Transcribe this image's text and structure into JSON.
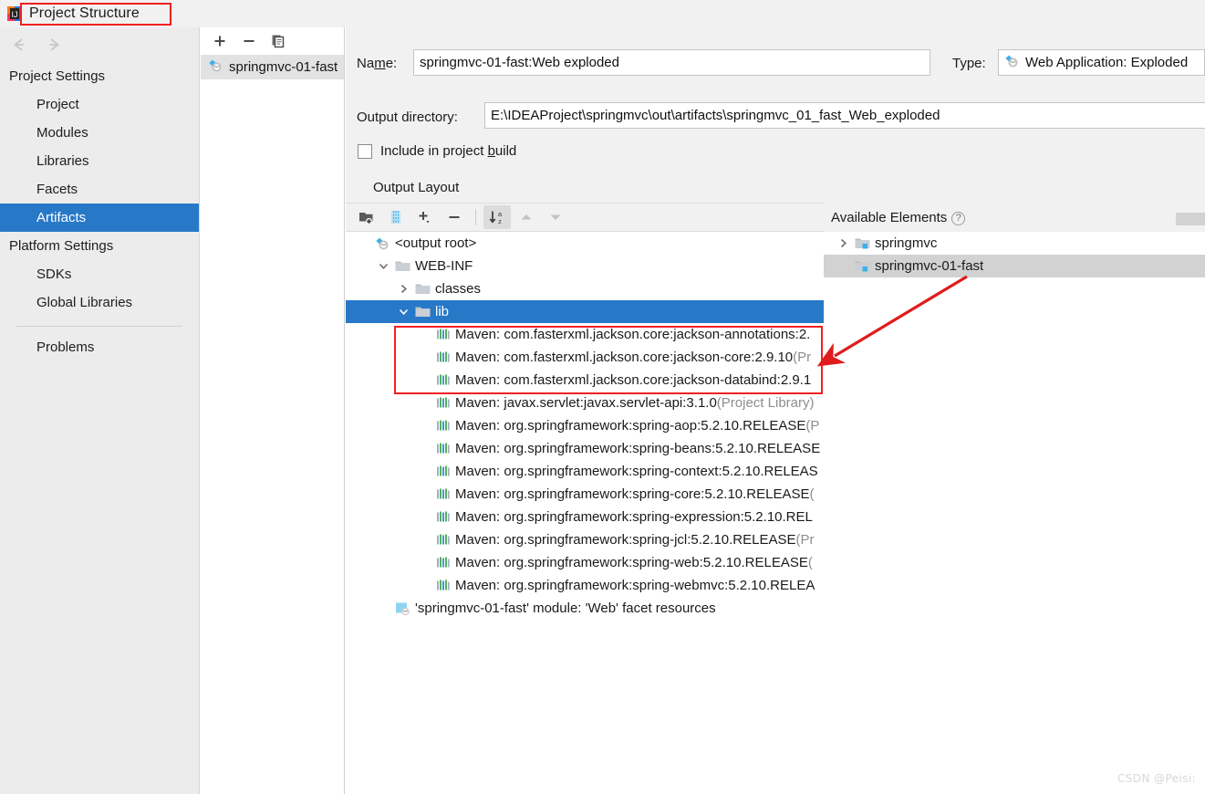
{
  "window": {
    "title": "Project Structure",
    "logo_icon": "intellij-idea-logo-icon"
  },
  "nav": {
    "back_icon": "arrow-left-icon",
    "forward_icon": "arrow-right-icon"
  },
  "sidebar": {
    "groups": [
      {
        "label": "Project Settings",
        "items": [
          {
            "label": "Project",
            "selected": false
          },
          {
            "label": "Modules",
            "selected": false
          },
          {
            "label": "Libraries",
            "selected": false
          },
          {
            "label": "Facets",
            "selected": false
          },
          {
            "label": "Artifacts",
            "selected": true
          }
        ]
      },
      {
        "label": "Platform Settings",
        "items": [
          {
            "label": "SDKs",
            "selected": false
          },
          {
            "label": "Global Libraries",
            "selected": false
          }
        ]
      }
    ],
    "problems": "Problems"
  },
  "artifacts_panel": {
    "toolbar": [
      {
        "name": "add-artifact-button",
        "glyph": "+"
      },
      {
        "name": "remove-artifact-button",
        "glyph": "−"
      },
      {
        "name": "copy-artifact-button",
        "glyph": "copy-icon"
      }
    ],
    "items": [
      {
        "label": "springmvc-01-fast",
        "icon": "artifact-icon",
        "selected": true
      }
    ]
  },
  "detail": {
    "name_label": "Name:",
    "name_label_mnemonic": "m",
    "name_value": "springmvc-01-fast:Web exploded",
    "type_label": "Type:",
    "type_value": "Web Application: Exploded",
    "type_icon": "artifact-icon",
    "output_dir_label": "Output directory:",
    "output_dir_value": "E:\\IDEAProject\\springmvc\\out\\artifacts\\springmvc_01_fast_Web_exploded",
    "include_checkbox_label": "Include in project build",
    "include_checked": false,
    "output_layout_label": "Output Layout"
  },
  "layout_toolbar": [
    {
      "name": "add-directory-button",
      "icon": "folder-add-icon",
      "active": false
    },
    {
      "name": "add-archive-button",
      "icon": "archive-icon",
      "active": false
    },
    {
      "name": "add-element-button",
      "icon": "plus-dropdown-icon",
      "active": false
    },
    {
      "name": "remove-element-button",
      "icon": "minus-icon",
      "active": false
    },
    {
      "name": "sort-alphabetically-button",
      "icon": "sort-az-icon",
      "active": true
    },
    {
      "name": "move-up-button",
      "icon": "chevron-up-icon",
      "active": false
    },
    {
      "name": "move-down-button",
      "icon": "chevron-down-icon",
      "active": false
    }
  ],
  "output_tree": [
    {
      "label": "<output root>",
      "icon": "artifact-icon",
      "indent": 0,
      "twist": "none",
      "selected": false,
      "suffix": ""
    },
    {
      "label": "WEB-INF",
      "icon": "folder-icon",
      "indent": 1,
      "twist": "expanded",
      "selected": false,
      "suffix": ""
    },
    {
      "label": "classes",
      "icon": "folder-icon",
      "indent": 2,
      "twist": "collapsed",
      "selected": false,
      "suffix": ""
    },
    {
      "label": "lib",
      "icon": "folder-icon",
      "indent": 2,
      "twist": "expanded",
      "selected": true,
      "suffix": ""
    },
    {
      "label": "Maven: com.fasterxml.jackson.core:jackson-annotations:2.",
      "icon": "library-icon",
      "indent": 3,
      "twist": "none",
      "selected": false,
      "suffix": ""
    },
    {
      "label": "Maven: com.fasterxml.jackson.core:jackson-core:2.9.10 ",
      "icon": "library-icon",
      "indent": 3,
      "twist": "none",
      "selected": false,
      "suffix": "(Pr"
    },
    {
      "label": "Maven: com.fasterxml.jackson.core:jackson-databind:2.9.1",
      "icon": "library-icon",
      "indent": 3,
      "twist": "none",
      "selected": false,
      "suffix": ""
    },
    {
      "label": "Maven: javax.servlet:javax.servlet-api:3.1.0 ",
      "icon": "library-icon",
      "indent": 3,
      "twist": "none",
      "selected": false,
      "suffix": "(Project Library)"
    },
    {
      "label": "Maven: org.springframework:spring-aop:5.2.10.RELEASE ",
      "icon": "library-icon",
      "indent": 3,
      "twist": "none",
      "selected": false,
      "suffix": "(P"
    },
    {
      "label": "Maven: org.springframework:spring-beans:5.2.10.RELEASE",
      "icon": "library-icon",
      "indent": 3,
      "twist": "none",
      "selected": false,
      "suffix": ""
    },
    {
      "label": "Maven: org.springframework:spring-context:5.2.10.RELEAS",
      "icon": "library-icon",
      "indent": 3,
      "twist": "none",
      "selected": false,
      "suffix": ""
    },
    {
      "label": "Maven: org.springframework:spring-core:5.2.10.RELEASE ",
      "icon": "library-icon",
      "indent": 3,
      "twist": "none",
      "selected": false,
      "suffix": "("
    },
    {
      "label": "Maven: org.springframework:spring-expression:5.2.10.REL",
      "icon": "library-icon",
      "indent": 3,
      "twist": "none",
      "selected": false,
      "suffix": ""
    },
    {
      "label": "Maven: org.springframework:spring-jcl:5.2.10.RELEASE ",
      "icon": "library-icon",
      "indent": 3,
      "twist": "none",
      "selected": false,
      "suffix": "(Pr"
    },
    {
      "label": "Maven: org.springframework:spring-web:5.2.10.RELEASE ",
      "icon": "library-icon",
      "indent": 3,
      "twist": "none",
      "selected": false,
      "suffix": "("
    },
    {
      "label": "Maven: org.springframework:spring-webmvc:5.2.10.RELEA",
      "icon": "library-icon",
      "indent": 3,
      "twist": "none",
      "selected": false,
      "suffix": ""
    },
    {
      "label": "'springmvc-01-fast' module: 'Web' facet resources",
      "icon": "facet-resources-icon",
      "indent": 1,
      "twist": "none",
      "selected": false,
      "suffix": ""
    }
  ],
  "available_elements": {
    "header": "Available Elements",
    "help_icon": "question-mark-icon",
    "items": [
      {
        "label": "springmvc",
        "icon": "module-icon",
        "twist": "collapsed",
        "selected": false
      },
      {
        "label": "springmvc-01-fast",
        "icon": "module-icon",
        "twist": "none",
        "selected": true
      }
    ]
  },
  "annotations": {
    "color": "#f02020",
    "title_box": true,
    "jackson_box": true,
    "arrow": true
  },
  "watermark": "CSDN @Peisi:",
  "colors": {
    "selection_blue": "#2878c8",
    "sidebar_bg": "#ececec",
    "panel_bg": "#f1f1f1",
    "annotation_red": "#f02020"
  }
}
